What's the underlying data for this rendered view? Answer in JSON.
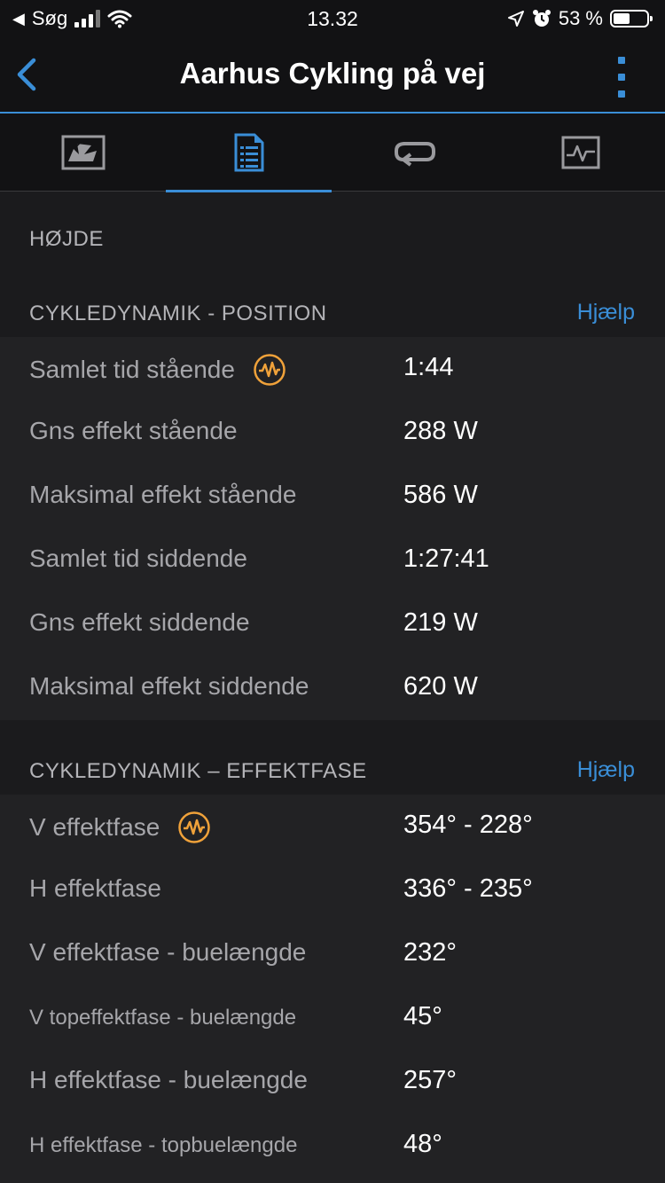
{
  "status_bar": {
    "carrier": "Søg",
    "time": "13.32",
    "battery": "53 %"
  },
  "header": {
    "title": "Aarhus Cykling på vej"
  },
  "tabs": [
    {
      "icon": "map-icon",
      "active": false
    },
    {
      "icon": "details-icon",
      "active": true
    },
    {
      "icon": "laps-icon",
      "active": false
    },
    {
      "icon": "chart-icon",
      "active": false
    }
  ],
  "sections": {
    "elevation": {
      "title": "HØJDE"
    },
    "position": {
      "title": "CYKLEDYNAMIK - POSITION",
      "help": "Hjælp",
      "rows": [
        {
          "label": "Samlet tid stående",
          "value": "1:44",
          "has_icon": true
        },
        {
          "label": "Gns effekt stående",
          "value": "288 W"
        },
        {
          "label": "Maksimal effekt stående",
          "value": "586 W"
        },
        {
          "label": "Samlet tid siddende",
          "value": "1:27:41"
        },
        {
          "label": "Gns effekt siddende",
          "value": "219 W"
        },
        {
          "label": "Maksimal effekt siddende",
          "value": "620 W"
        }
      ]
    },
    "power_phase": {
      "title": "CYKLEDYNAMIK – EFFEKTFASE",
      "help": "Hjælp",
      "rows": [
        {
          "label": "V effektfase",
          "value": "354° - 228°",
          "has_icon": true
        },
        {
          "label": "H effektfase",
          "value": "336° - 235°"
        },
        {
          "label": "V effektfase - buelængde",
          "value": "232°"
        },
        {
          "label": "V topeffektfase - buelængde",
          "value": "45°"
        },
        {
          "label": "H effektfase - buelængde",
          "value": "257°"
        },
        {
          "label": "H effektfase - topbuelængde",
          "value": "48°"
        }
      ]
    }
  },
  "colors": {
    "accent": "#3a8ed7",
    "badge": "#f0a23a",
    "background": "#1b1b1d",
    "row_background": "#222224"
  }
}
